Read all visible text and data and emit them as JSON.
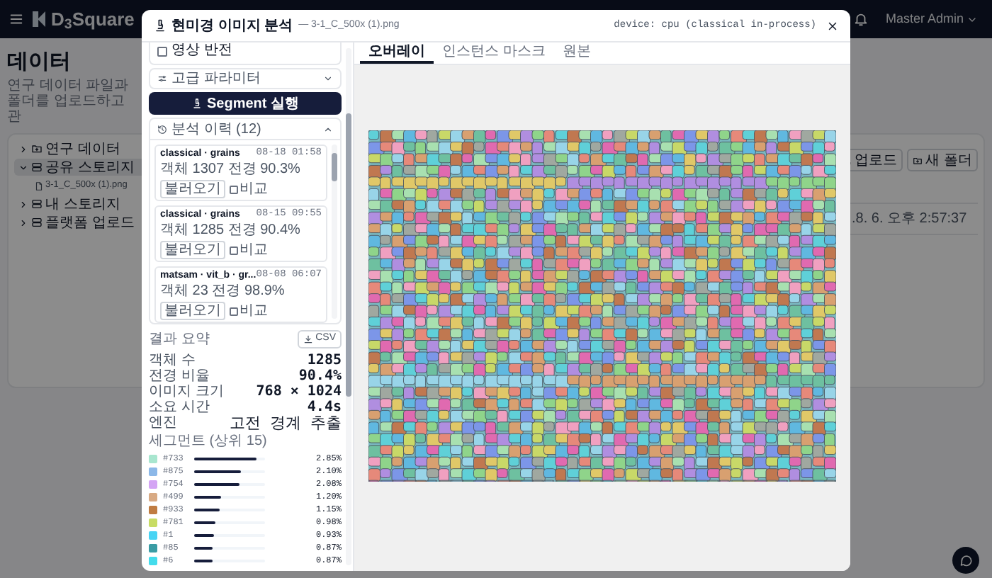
{
  "topbar": {
    "logo": "D$_{3}$Square",
    "user": "Master Admin"
  },
  "page": {
    "title": "데이터",
    "subtitle": "연구 데이터 파일과 폴더를 업로드하고 관",
    "tree": [
      {
        "label": "연구 데이터",
        "kind": "folder",
        "expanded": false,
        "selected": false
      },
      {
        "label": "공유 스토리지",
        "kind": "storage",
        "expanded": true,
        "selected": true,
        "children": [
          {
            "label": "3-1_C_500x (1).png",
            "kind": "file"
          }
        ]
      },
      {
        "label": "내 스토리지",
        "kind": "storage",
        "expanded": false,
        "selected": false
      },
      {
        "label": "플랫폼 업로드",
        "kind": "storage",
        "expanded": false,
        "selected": false
      }
    ],
    "actions": [
      {
        "label": "업로드",
        "kind": "upload"
      },
      {
        "label": "새 폴더",
        "kind": "folder"
      }
    ],
    "row_date": ".8. 6. 오후 2:57:37"
  },
  "dialog": {
    "title": "현미경 이미지 분석",
    "filename": "— 3-1_C_500x (1).png",
    "device": "device: cpu (classical in-process)",
    "options": [
      {
        "label": "영상 반전",
        "checked": false
      }
    ],
    "advanced": {
      "label": "고급 파라미터",
      "expanded": false
    },
    "run_button": "Segment 실행",
    "history": {
      "title": "분석 이력 (12)",
      "expanded": true,
      "items": [
        {
          "model": "classical · grains",
          "time": "08-18 01:58",
          "stats": "객체 1307 전경 90.3%",
          "load": "불러오기",
          "compare": "비교",
          "checked": false
        },
        {
          "model": "classical · grains",
          "time": "08-15 09:55",
          "stats": "객체 1285 전경 90.4%",
          "load": "불러오기",
          "compare": "비교",
          "checked": false
        },
        {
          "model": "matsam · vit_b · gr...",
          "time": "08-08 06:07",
          "stats": "객체 23 전경 98.9%",
          "load": "불러오기",
          "compare": "비교",
          "checked": false
        }
      ]
    },
    "summary": {
      "title": "결과 요약",
      "csv": "CSV",
      "rows": [
        {
          "label": "객체 수",
          "value": "1285"
        },
        {
          "label": "전경 비율",
          "value": "90.4%"
        },
        {
          "label": "이미지 크기",
          "value": "768 × 1024"
        },
        {
          "label": "소요 시간",
          "value": "4.4s"
        },
        {
          "label": "엔진",
          "value": "고전 경계 추출",
          "kind": "large"
        }
      ]
    },
    "segments": {
      "title": "세그먼트 (상위 15)",
      "items": [
        {
          "id": "#733",
          "color": "#a8e6cf",
          "level": 0.88,
          "pct": "2.85%"
        },
        {
          "id": "#875",
          "color": "#8cb8e8",
          "level": 0.65,
          "pct": "2.10%"
        },
        {
          "id": "#754",
          "color": "#d4a4f4",
          "level": 0.64,
          "pct": "2.08%"
        },
        {
          "id": "#499",
          "color": "#d8aa84",
          "level": 0.37,
          "pct": "1.20%"
        },
        {
          "id": "#933",
          "color": "#c07c42",
          "level": 0.35,
          "pct": "1.15%"
        },
        {
          "id": "#781",
          "color": "#c8dc64",
          "level": 0.3,
          "pct": "0.98%"
        },
        {
          "id": "#1",
          "color": "#48d4f4",
          "level": 0.28,
          "pct": "0.93%"
        },
        {
          "id": "#85",
          "color": "#3a9ca4",
          "level": 0.26,
          "pct": "0.87%"
        },
        {
          "id": "#6",
          "color": "#44dcec",
          "level": 0.26,
          "pct": "0.87%"
        }
      ]
    },
    "tabs": [
      {
        "label": "오버레이",
        "selected": true
      },
      {
        "label": "인스턴스 마스크",
        "selected": false
      },
      {
        "label": "원본",
        "selected": false
      }
    ]
  }
}
